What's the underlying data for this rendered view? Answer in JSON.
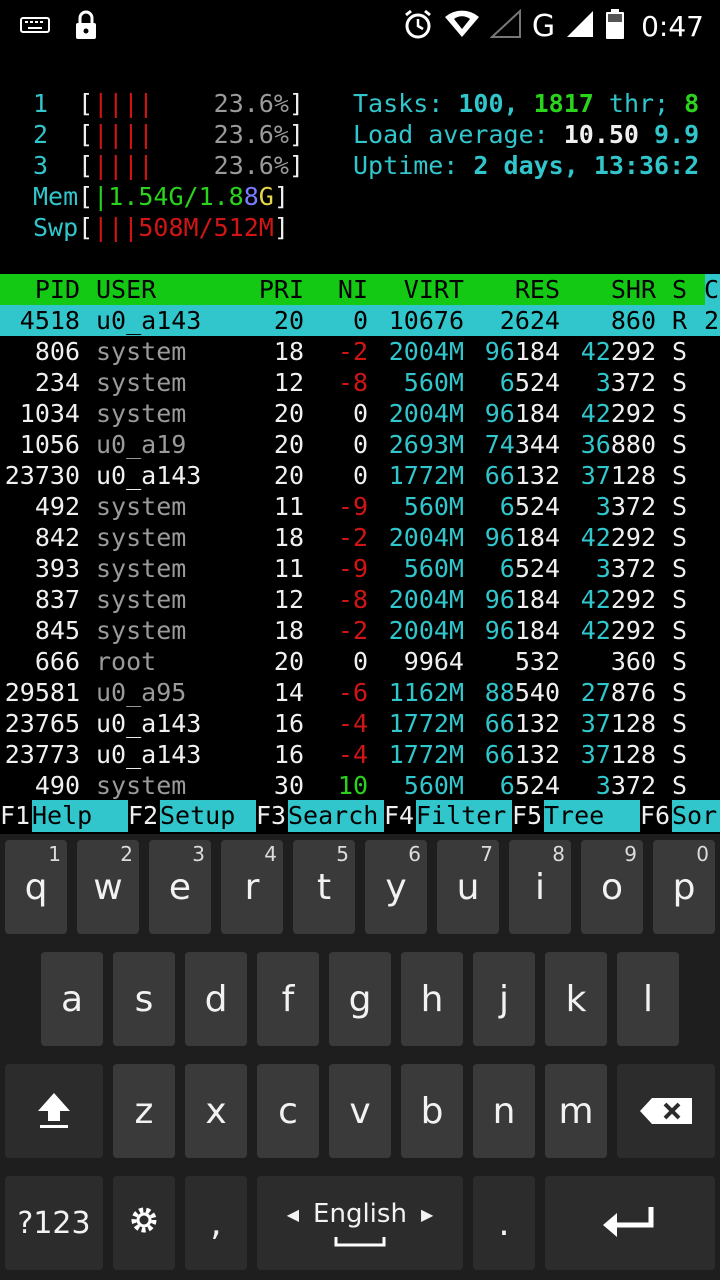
{
  "status_bar": {
    "time": "0:47",
    "network": "G",
    "icons": [
      "keyboard-icon",
      "lock-icon",
      "alarm-icon",
      "wifi-icon",
      "signal-icon",
      "battery-icon"
    ]
  },
  "meters": {
    "cpu": [
      {
        "id": "1",
        "bars": "||||",
        "pct": "23.6%"
      },
      {
        "id": "2",
        "bars": "||||",
        "pct": "23.6%"
      },
      {
        "id": "3",
        "bars": "||||",
        "pct": "23.6%"
      }
    ],
    "mem": {
      "label": "Mem",
      "value_a": "|1.54G/1.8",
      "value_b": "8",
      "value_c": "G"
    },
    "swp": {
      "label": "Swp",
      "bars": "|||",
      "value": "508M/512M"
    },
    "tasks_label": "Tasks: ",
    "tasks_count": "100, ",
    "threads": "1817",
    "thr_label": " thr; ",
    "running": "8",
    "load_label": "Load average: ",
    "load_1": "10.50 ",
    "load_5": "9.9",
    "uptime_label": "Uptime: ",
    "uptime_value": "2 days, 13:36:2"
  },
  "table": {
    "headers": {
      "pid": "PID",
      "user": "USER",
      "pri": "PRI",
      "ni": "NI",
      "virt": "VIRT",
      "res": "RES",
      "shr": "SHR",
      "s": "S",
      "c": "C"
    },
    "rows": [
      {
        "pid": "4518",
        "user": "u0_a143",
        "pri": "20",
        "ni": "0",
        "virt": "10676",
        "res": "2624",
        "shr": "860",
        "s": "R",
        "c": "2",
        "selected": true
      },
      {
        "pid": "806",
        "user": "system",
        "pri": "18",
        "ni": "-2",
        "virt": "2004M",
        "res_a": "96",
        "res_b": "184",
        "shr_a": "42",
        "shr_b": "292",
        "s": "S"
      },
      {
        "pid": "234",
        "user": "system",
        "pri": "12",
        "ni": "-8",
        "virt": "560M",
        "res_a": "6",
        "res_b": "524",
        "shr_a": "3",
        "shr_b": "372",
        "s": "S"
      },
      {
        "pid": "1034",
        "user": "system",
        "pri": "20",
        "ni": "0",
        "virt": "2004M",
        "res_a": "96",
        "res_b": "184",
        "shr_a": "42",
        "shr_b": "292",
        "s": "S"
      },
      {
        "pid": "1056",
        "user": "u0_a19",
        "pri": "20",
        "ni": "0",
        "virt": "2693M",
        "res_a": "74",
        "res_b": "344",
        "shr_a": "36",
        "shr_b": "880",
        "s": "S"
      },
      {
        "pid": "23730",
        "user": "u0_a143",
        "pri": "20",
        "ni": "0",
        "virt": "1772M",
        "res_a": "66",
        "res_b": "132",
        "shr_a": "37",
        "shr_b": "128",
        "s": "S"
      },
      {
        "pid": "492",
        "user": "system",
        "pri": "11",
        "ni": "-9",
        "virt": "560M",
        "res_a": "6",
        "res_b": "524",
        "shr_a": "3",
        "shr_b": "372",
        "s": "S"
      },
      {
        "pid": "842",
        "user": "system",
        "pri": "18",
        "ni": "-2",
        "virt": "2004M",
        "res_a": "96",
        "res_b": "184",
        "shr_a": "42",
        "shr_b": "292",
        "s": "S"
      },
      {
        "pid": "393",
        "user": "system",
        "pri": "11",
        "ni": "-9",
        "virt": "560M",
        "res_a": "6",
        "res_b": "524",
        "shr_a": "3",
        "shr_b": "372",
        "s": "S"
      },
      {
        "pid": "837",
        "user": "system",
        "pri": "12",
        "ni": "-8",
        "virt": "2004M",
        "res_a": "96",
        "res_b": "184",
        "shr_a": "42",
        "shr_b": "292",
        "s": "S"
      },
      {
        "pid": "845",
        "user": "system",
        "pri": "18",
        "ni": "-2",
        "virt": "2004M",
        "res_a": "96",
        "res_b": "184",
        "shr_a": "42",
        "shr_b": "292",
        "s": "S"
      },
      {
        "pid": "666",
        "user": "root",
        "pri": "20",
        "ni": "0",
        "virt": "9964",
        "res_a": "",
        "res_b": "532",
        "shr_a": "",
        "shr_b": "360",
        "s": "S"
      },
      {
        "pid": "29581",
        "user": "u0_a95",
        "pri": "14",
        "ni": "-6",
        "virt": "1162M",
        "res_a": "88",
        "res_b": "540",
        "shr_a": "27",
        "shr_b": "876",
        "s": "S"
      },
      {
        "pid": "23765",
        "user": "u0_a143",
        "pri": "16",
        "ni": "-4",
        "virt": "1772M",
        "res_a": "66",
        "res_b": "132",
        "shr_a": "37",
        "shr_b": "128",
        "s": "S"
      },
      {
        "pid": "23773",
        "user": "u0_a143",
        "pri": "16",
        "ni": "-4",
        "virt": "1772M",
        "res_a": "66",
        "res_b": "132",
        "shr_a": "37",
        "shr_b": "128",
        "s": "S"
      },
      {
        "pid": "490",
        "user": "system",
        "pri": "30",
        "ni": "10",
        "virt": "560M",
        "res_a": "6",
        "res_b": "524",
        "shr_a": "3",
        "shr_b": "372",
        "s": "S"
      }
    ]
  },
  "function_bar": [
    {
      "key": "F1",
      "label": "Help  "
    },
    {
      "key": "F2",
      "label": "Setup "
    },
    {
      "key": "F3",
      "label": "Search"
    },
    {
      "key": "F4",
      "label": "Filter"
    },
    {
      "key": "F5",
      "label": "Tree  "
    },
    {
      "key": "F6",
      "label": "Sor"
    }
  ],
  "keyboard": {
    "row1": [
      {
        "k": "q",
        "h": "1"
      },
      {
        "k": "w",
        "h": "2"
      },
      {
        "k": "e",
        "h": "3"
      },
      {
        "k": "r",
        "h": "4"
      },
      {
        "k": "t",
        "h": "5"
      },
      {
        "k": "y",
        "h": "6"
      },
      {
        "k": "u",
        "h": "7"
      },
      {
        "k": "i",
        "h": "8"
      },
      {
        "k": "o",
        "h": "9"
      },
      {
        "k": "p",
        "h": "0"
      }
    ],
    "row2": [
      "a",
      "s",
      "d",
      "f",
      "g",
      "h",
      "j",
      "k",
      "l"
    ],
    "row3": [
      "z",
      "x",
      "c",
      "v",
      "b",
      "n",
      "m"
    ],
    "symbols_label": "?123",
    "comma": ",",
    "space_label": "English",
    "period": "."
  }
}
